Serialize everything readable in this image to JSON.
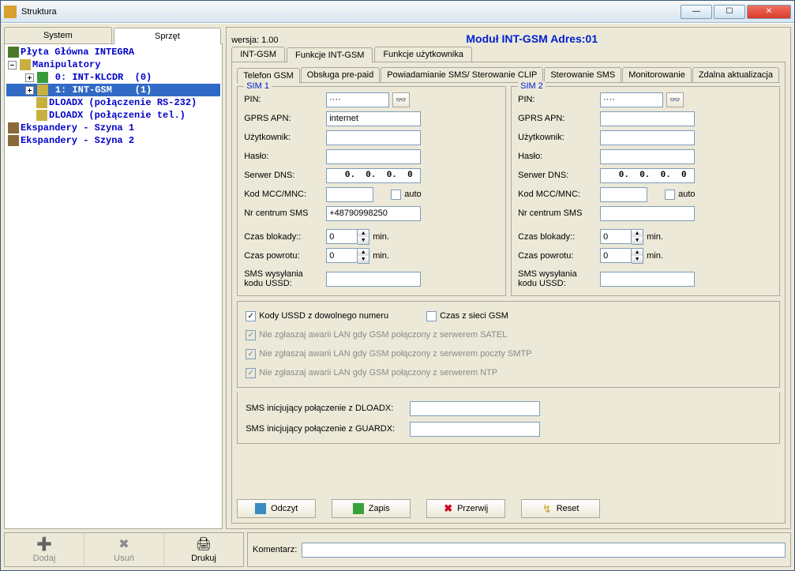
{
  "window": {
    "title": "Struktura"
  },
  "leftTabs": {
    "system": "System",
    "hardware": "Sprzęt"
  },
  "tree": {
    "root": "Płyta Główna INTEGRA",
    "manip": "Manipulatory",
    "item0": " 0: INT-KLCDR  (0)",
    "item1": " 1: INT-GSM    (1)",
    "item2": "DLOADX (połączenie RS-232)",
    "item3": "DLOADX (połączenie tel.)",
    "exp1": "Ekspandery - Szyna 1",
    "exp2": "Ekspandery - Szyna 2"
  },
  "right": {
    "version": "wersja: 1.00",
    "title": "Moduł INT-GSM Adres:01",
    "mainTabs": {
      "t1": "INT-GSM",
      "t2": "Funkcje INT-GSM",
      "t3": "Funkcje użytkownika"
    },
    "subTabs": {
      "s1": "Telefon GSM",
      "s2": "Obsługa pre-paid",
      "s3": "Powiadamianie SMS/ Sterowanie CLIP",
      "s4": "Sterowanie SMS",
      "s5": "Monitorowanie",
      "s6": "Zdalna aktualizacja"
    },
    "labels": {
      "sim1": "SIM 1",
      "sim2": "SIM 2",
      "pin": "PIN:",
      "apn": "GPRS APN:",
      "user": "Użytkownik:",
      "pass": "Hasło:",
      "dns": "Serwer DNS:",
      "mcc": "Kod MCC/MNC:",
      "auto": "auto",
      "smsc": "Nr centrum SMS",
      "lock": "Czas blokady::",
      "ret": "Czas powrotu:",
      "min": "min.",
      "ussd": "SMS wysyłania kodu USSD:"
    },
    "sim1": {
      "pin": "····",
      "apn": "internet",
      "user": "",
      "pass": "",
      "dns": "  0.  0.  0.  0",
      "mcc": "",
      "smsc": "+48790998250",
      "lock": "0",
      "ret": "0",
      "ussd": ""
    },
    "sim2": {
      "pin": "····",
      "apn": "",
      "user": "",
      "pass": "",
      "dns": "  0.  0.  0.  0",
      "mcc": "",
      "smsc": "",
      "lock": "0",
      "ret": "0",
      "ussd": ""
    },
    "checks": {
      "ussdAny": "Kody USSD z dowolnego numeru",
      "gsmTime": "Czas z sieci GSM",
      "lanSatel": "Nie zgłaszaj awarii LAN gdy GSM połączony z serwerem SATEL",
      "lanSmtp": "Nie zgłaszaj awarii LAN gdy GSM połączony z serwerem poczty SMTP",
      "lanNtp": "Nie zgłaszaj awarii LAN gdy GSM połączony z serwerem NTP"
    },
    "smsInit": {
      "dloadx": "SMS inicjujący połączenie z DLOADX:",
      "guardx": "SMS inicjujący połączenie z GUARDX:"
    },
    "buttons": {
      "read": "Odczyt",
      "write": "Zapis",
      "abort": "Przerwij",
      "reset": "Reset"
    }
  },
  "bottom": {
    "add": "Dodaj",
    "del": "Usuń",
    "print": "Drukuj",
    "comment": "Komentarz:"
  }
}
